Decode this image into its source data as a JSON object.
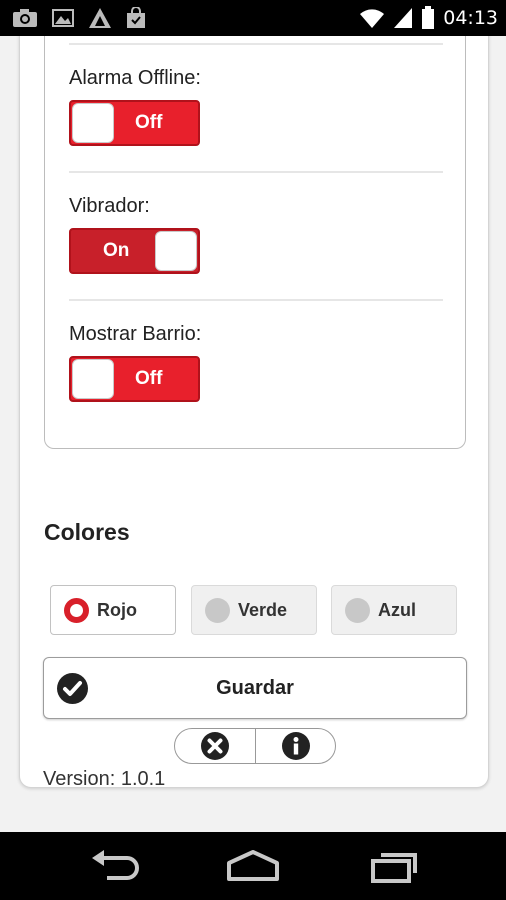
{
  "status_bar": {
    "time": "04:13",
    "left_icons": [
      "camera-icon",
      "image-icon",
      "app-icon",
      "shopping-bag-icon"
    ],
    "right_icons": [
      "wifi-icon",
      "signal-icon",
      "battery-icon"
    ]
  },
  "settings": [
    {
      "label": "Alarma Offline:",
      "state": "Off"
    },
    {
      "label": "Vibrador:",
      "state": "On"
    },
    {
      "label": "Mostrar Barrio:",
      "state": "Off"
    }
  ],
  "colors": {
    "title": "Colores",
    "options": [
      {
        "label": "Rojo",
        "selected": true
      },
      {
        "label": "Verde",
        "selected": false
      },
      {
        "label": "Azul",
        "selected": false
      }
    ],
    "accent": "#e8202c"
  },
  "save_button": {
    "label": "Guardar",
    "icon": "check-circle-icon"
  },
  "actions": {
    "close_icon": "close-circle-icon",
    "info_icon": "info-circle-icon"
  },
  "version": "Version: 1.0.1",
  "nav": {
    "back": "back-icon",
    "home": "home-icon",
    "recents": "recents-icon"
  }
}
